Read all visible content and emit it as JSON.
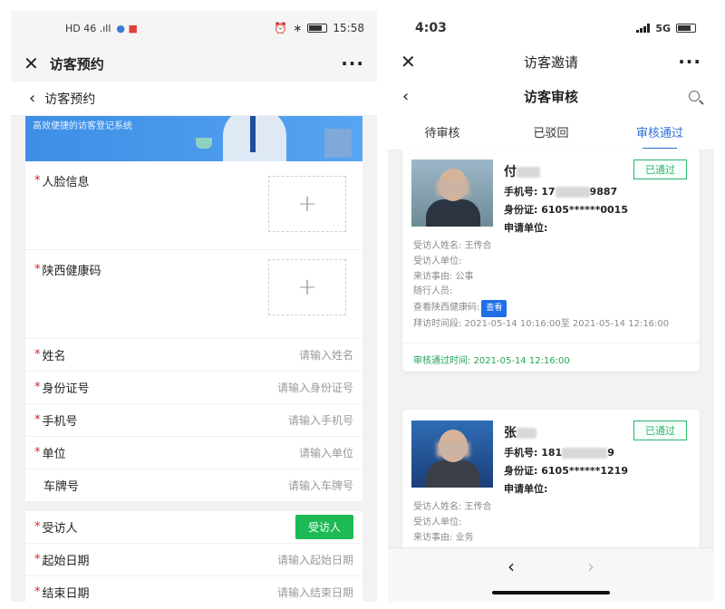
{
  "left": {
    "status": {
      "left_text": "HD 46 .ıll",
      "time": "15:58"
    },
    "app_title": "访客预约",
    "sub_title": "访客预约",
    "banner_text": "高效便捷的访客登记系统",
    "form": {
      "face_label": "人脸信息",
      "health_label": "陕西健康码",
      "fields": [
        {
          "label": "姓名",
          "placeholder": "请输入姓名"
        },
        {
          "label": "身份证号",
          "placeholder": "请输入身份证号"
        },
        {
          "label": "手机号",
          "placeholder": "请输入手机号"
        },
        {
          "label": "单位",
          "placeholder": "请输入单位"
        },
        {
          "label": "车牌号",
          "placeholder": "请输入车牌号"
        }
      ],
      "visitee_label": "受访人",
      "visitee_button": "受访人",
      "start_label": "起始日期",
      "start_placeholder": "请输入起始日期",
      "end_label": "结束日期",
      "end_placeholder": "请输入结束日期"
    }
  },
  "right": {
    "status": {
      "time": "4:03",
      "network": "5G"
    },
    "app_title": "访客邀请",
    "nav_title": "访客审核",
    "tabs": [
      "待审核",
      "已驳回",
      "审核通过"
    ],
    "cards": [
      {
        "name": "付",
        "phone_prefix": "手机号: 17",
        "phone_suffix": "9887",
        "id": "身份证: 6105******0015",
        "unit": "申请单位:",
        "status": "已通过",
        "host_name": "受访人姓名: 王传合",
        "host_unit": "受访人单位:",
        "reason": "来访事由: 公事",
        "companions": "随行人员:",
        "health_label": "查看陕西健康码:",
        "view_button": "查看",
        "visit_period": "拜访时间段: 2021-05-14 10:16:00至 2021-05-14 12:16:00",
        "approved_time": "审核通过时间: 2021-05-14 12:16:00"
      },
      {
        "name": "张",
        "phone_prefix": "手机号: 181",
        "phone_suffix": "9",
        "id": "身份证: 6105******1219",
        "unit": "申请单位:",
        "status": "已通过",
        "host_name": "受访人姓名: 王传合",
        "host_unit": "受访人单位:",
        "reason": "来访事由: 业务"
      }
    ],
    "bottom_nav": {
      "back": "‹",
      "forward": "›"
    }
  }
}
